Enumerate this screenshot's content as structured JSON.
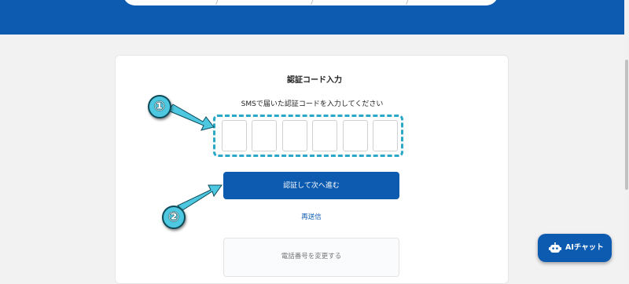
{
  "auth": {
    "title": "認証コード入力",
    "instruction": "SMSで届いた認証コードを入力してください",
    "code_digits": [
      "",
      "",
      "",
      "",
      "",
      ""
    ],
    "submit_label": "認証して次へ進む",
    "resend_label": "再送信",
    "change_phone_label": "電話番号を変更する"
  },
  "annotations": {
    "marker_1": "①",
    "marker_2": "②",
    "color": "#4ec8e0"
  },
  "chat": {
    "label": "AIチャット",
    "icon": "robot-icon"
  },
  "colors": {
    "brand_blue": "#0c5bb0",
    "highlight": "#2ba8c8",
    "background": "#f2f2f2"
  }
}
